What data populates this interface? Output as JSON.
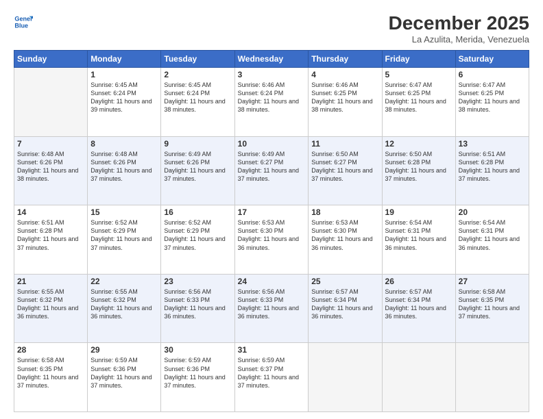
{
  "header": {
    "month_title": "December 2025",
    "location": "La Azulita, Merida, Venezuela",
    "logo_line1": "General",
    "logo_line2": "Blue"
  },
  "days_of_week": [
    "Sunday",
    "Monday",
    "Tuesday",
    "Wednesday",
    "Thursday",
    "Friday",
    "Saturday"
  ],
  "weeks": [
    [
      {
        "day": "",
        "sunrise": "",
        "sunset": "",
        "daylight": "",
        "empty": true
      },
      {
        "day": "1",
        "sunrise": "Sunrise: 6:45 AM",
        "sunset": "Sunset: 6:24 PM",
        "daylight": "Daylight: 11 hours and 39 minutes."
      },
      {
        "day": "2",
        "sunrise": "Sunrise: 6:45 AM",
        "sunset": "Sunset: 6:24 PM",
        "daylight": "Daylight: 11 hours and 38 minutes."
      },
      {
        "day": "3",
        "sunrise": "Sunrise: 6:46 AM",
        "sunset": "Sunset: 6:24 PM",
        "daylight": "Daylight: 11 hours and 38 minutes."
      },
      {
        "day": "4",
        "sunrise": "Sunrise: 6:46 AM",
        "sunset": "Sunset: 6:25 PM",
        "daylight": "Daylight: 11 hours and 38 minutes."
      },
      {
        "day": "5",
        "sunrise": "Sunrise: 6:47 AM",
        "sunset": "Sunset: 6:25 PM",
        "daylight": "Daylight: 11 hours and 38 minutes."
      },
      {
        "day": "6",
        "sunrise": "Sunrise: 6:47 AM",
        "sunset": "Sunset: 6:25 PM",
        "daylight": "Daylight: 11 hours and 38 minutes."
      }
    ],
    [
      {
        "day": "7",
        "sunrise": "Sunrise: 6:48 AM",
        "sunset": "Sunset: 6:26 PM",
        "daylight": "Daylight: 11 hours and 38 minutes."
      },
      {
        "day": "8",
        "sunrise": "Sunrise: 6:48 AM",
        "sunset": "Sunset: 6:26 PM",
        "daylight": "Daylight: 11 hours and 37 minutes."
      },
      {
        "day": "9",
        "sunrise": "Sunrise: 6:49 AM",
        "sunset": "Sunset: 6:26 PM",
        "daylight": "Daylight: 11 hours and 37 minutes."
      },
      {
        "day": "10",
        "sunrise": "Sunrise: 6:49 AM",
        "sunset": "Sunset: 6:27 PM",
        "daylight": "Daylight: 11 hours and 37 minutes."
      },
      {
        "day": "11",
        "sunrise": "Sunrise: 6:50 AM",
        "sunset": "Sunset: 6:27 PM",
        "daylight": "Daylight: 11 hours and 37 minutes."
      },
      {
        "day": "12",
        "sunrise": "Sunrise: 6:50 AM",
        "sunset": "Sunset: 6:28 PM",
        "daylight": "Daylight: 11 hours and 37 minutes."
      },
      {
        "day": "13",
        "sunrise": "Sunrise: 6:51 AM",
        "sunset": "Sunset: 6:28 PM",
        "daylight": "Daylight: 11 hours and 37 minutes."
      }
    ],
    [
      {
        "day": "14",
        "sunrise": "Sunrise: 6:51 AM",
        "sunset": "Sunset: 6:28 PM",
        "daylight": "Daylight: 11 hours and 37 minutes."
      },
      {
        "day": "15",
        "sunrise": "Sunrise: 6:52 AM",
        "sunset": "Sunset: 6:29 PM",
        "daylight": "Daylight: 11 hours and 37 minutes."
      },
      {
        "day": "16",
        "sunrise": "Sunrise: 6:52 AM",
        "sunset": "Sunset: 6:29 PM",
        "daylight": "Daylight: 11 hours and 37 minutes."
      },
      {
        "day": "17",
        "sunrise": "Sunrise: 6:53 AM",
        "sunset": "Sunset: 6:30 PM",
        "daylight": "Daylight: 11 hours and 36 minutes."
      },
      {
        "day": "18",
        "sunrise": "Sunrise: 6:53 AM",
        "sunset": "Sunset: 6:30 PM",
        "daylight": "Daylight: 11 hours and 36 minutes."
      },
      {
        "day": "19",
        "sunrise": "Sunrise: 6:54 AM",
        "sunset": "Sunset: 6:31 PM",
        "daylight": "Daylight: 11 hours and 36 minutes."
      },
      {
        "day": "20",
        "sunrise": "Sunrise: 6:54 AM",
        "sunset": "Sunset: 6:31 PM",
        "daylight": "Daylight: 11 hours and 36 minutes."
      }
    ],
    [
      {
        "day": "21",
        "sunrise": "Sunrise: 6:55 AM",
        "sunset": "Sunset: 6:32 PM",
        "daylight": "Daylight: 11 hours and 36 minutes."
      },
      {
        "day": "22",
        "sunrise": "Sunrise: 6:55 AM",
        "sunset": "Sunset: 6:32 PM",
        "daylight": "Daylight: 11 hours and 36 minutes."
      },
      {
        "day": "23",
        "sunrise": "Sunrise: 6:56 AM",
        "sunset": "Sunset: 6:33 PM",
        "daylight": "Daylight: 11 hours and 36 minutes."
      },
      {
        "day": "24",
        "sunrise": "Sunrise: 6:56 AM",
        "sunset": "Sunset: 6:33 PM",
        "daylight": "Daylight: 11 hours and 36 minutes."
      },
      {
        "day": "25",
        "sunrise": "Sunrise: 6:57 AM",
        "sunset": "Sunset: 6:34 PM",
        "daylight": "Daylight: 11 hours and 36 minutes."
      },
      {
        "day": "26",
        "sunrise": "Sunrise: 6:57 AM",
        "sunset": "Sunset: 6:34 PM",
        "daylight": "Daylight: 11 hours and 36 minutes."
      },
      {
        "day": "27",
        "sunrise": "Sunrise: 6:58 AM",
        "sunset": "Sunset: 6:35 PM",
        "daylight": "Daylight: 11 hours and 37 minutes."
      }
    ],
    [
      {
        "day": "28",
        "sunrise": "Sunrise: 6:58 AM",
        "sunset": "Sunset: 6:35 PM",
        "daylight": "Daylight: 11 hours and 37 minutes."
      },
      {
        "day": "29",
        "sunrise": "Sunrise: 6:59 AM",
        "sunset": "Sunset: 6:36 PM",
        "daylight": "Daylight: 11 hours and 37 minutes."
      },
      {
        "day": "30",
        "sunrise": "Sunrise: 6:59 AM",
        "sunset": "Sunset: 6:36 PM",
        "daylight": "Daylight: 11 hours and 37 minutes."
      },
      {
        "day": "31",
        "sunrise": "Sunrise: 6:59 AM",
        "sunset": "Sunset: 6:37 PM",
        "daylight": "Daylight: 11 hours and 37 minutes."
      },
      {
        "day": "",
        "sunrise": "",
        "sunset": "",
        "daylight": "",
        "empty": true
      },
      {
        "day": "",
        "sunrise": "",
        "sunset": "",
        "daylight": "",
        "empty": true
      },
      {
        "day": "",
        "sunrise": "",
        "sunset": "",
        "daylight": "",
        "empty": true
      }
    ]
  ]
}
